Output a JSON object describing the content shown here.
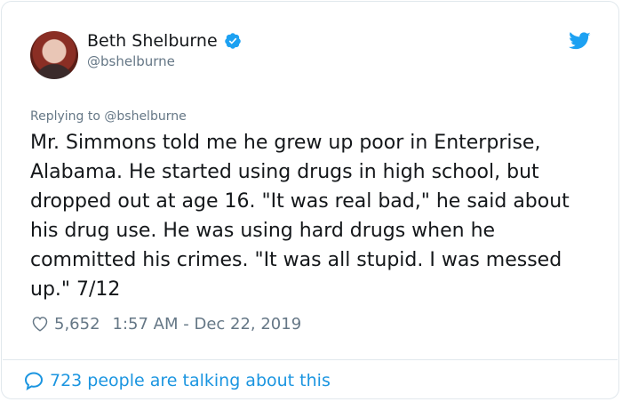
{
  "author": {
    "name": "Beth Shelburne",
    "handle": "@bshelburne"
  },
  "tweet": {
    "replying_prefix": "Replying to ",
    "replying_to": "@bshelburne",
    "text": "Mr. Simmons told me he grew up poor in Enterprise, Alabama. He started using drugs in high school, but dropped out at age 16. \"It was real bad,\" he said about his drug use. He was using hard drugs when he committed his crimes. \"It was all stupid. I was messed up.\" 7/12",
    "likes": "5,652",
    "timestamp": "1:57 AM - Dec 22, 2019"
  },
  "footer": {
    "talking": "723 people are talking about this"
  },
  "icons": {
    "verified": "verified-badge-icon",
    "bird": "twitter-bird-icon",
    "heart": "heart-icon",
    "bubble": "speech-bubble-icon"
  },
  "colors": {
    "accent": "#1da1f2",
    "link": "#1b95e0",
    "text": "#14171a",
    "muted": "#657786",
    "border": "#e1e8ed"
  }
}
